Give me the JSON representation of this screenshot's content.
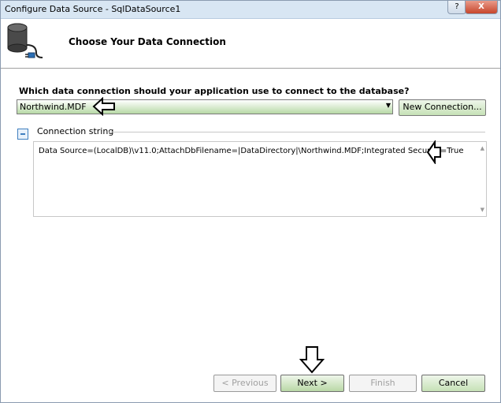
{
  "window": {
    "title": "Configure Data Source - SqlDataSource1",
    "help_label": "?",
    "close_label": "X"
  },
  "header": {
    "title": "Choose Your Data Connection",
    "icon": "database-plug-icon"
  },
  "connection": {
    "question": "Which data connection should your application use to connect to the database?",
    "selected": "Northwind.MDF",
    "new_connection_label": "New Connection...",
    "section_label": "Connection string",
    "connection_string": "Data Source=(LocalDB)\\v11.0;AttachDbFilename=|DataDirectory|\\Northwind.MDF;Integrated Security=True"
  },
  "footer": {
    "previous_label": "< Previous",
    "next_label": "Next >",
    "finish_label": "Finish",
    "cancel_label": "Cancel"
  },
  "colors": {
    "accent_green": "#b9d8a6",
    "titlebar": "#d8e6f3"
  }
}
